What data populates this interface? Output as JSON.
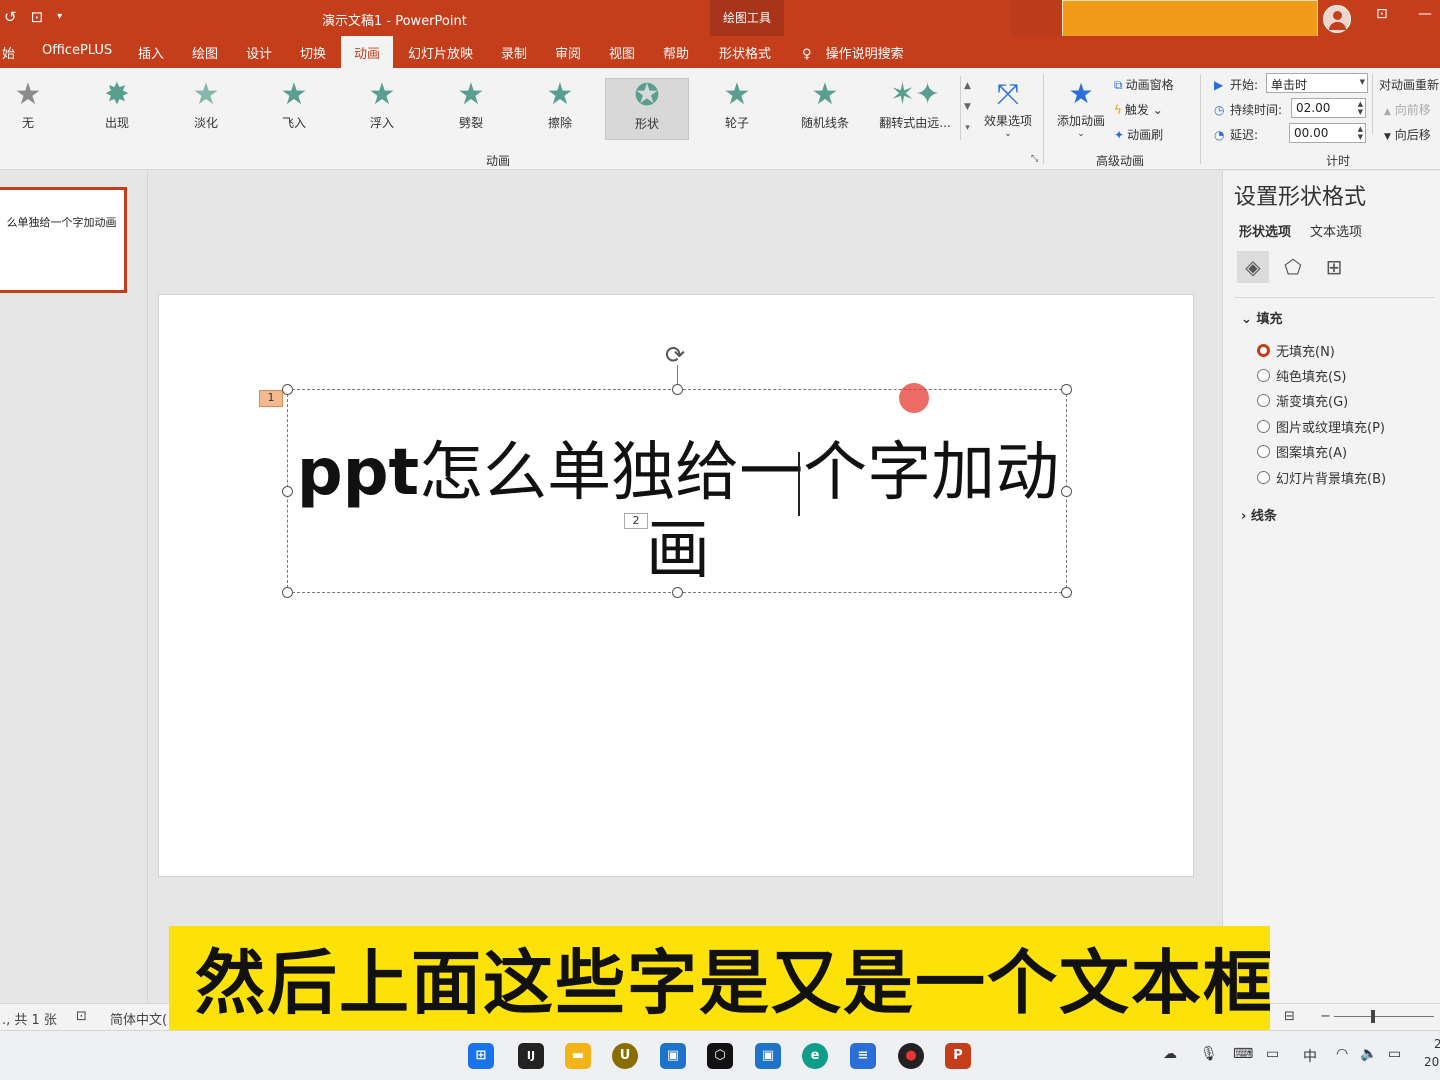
{
  "window": {
    "title": "演示文稿1  -  PowerPoint",
    "contextual_tab_header": "绘图工具"
  },
  "tabs": [
    {
      "label": "始"
    },
    {
      "label": "OfficePLUS"
    },
    {
      "label": "插入"
    },
    {
      "label": "绘图"
    },
    {
      "label": "设计"
    },
    {
      "label": "切换"
    },
    {
      "label": "动画",
      "active": true
    },
    {
      "label": "幻灯片放映"
    },
    {
      "label": "录制"
    },
    {
      "label": "审阅"
    },
    {
      "label": "视图"
    },
    {
      "label": "帮助"
    },
    {
      "label": "形状格式"
    },
    {
      "label": "操作说明搜索"
    }
  ],
  "ribbon": {
    "animations": [
      {
        "label": "无"
      },
      {
        "label": "出现"
      },
      {
        "label": "淡化"
      },
      {
        "label": "飞入"
      },
      {
        "label": "浮入"
      },
      {
        "label": "劈裂"
      },
      {
        "label": "擦除"
      },
      {
        "label": "形状",
        "selected": true
      },
      {
        "label": "轮子"
      },
      {
        "label": "随机线条"
      },
      {
        "label": "翻转式由远..."
      }
    ],
    "effect_options": "效果选项",
    "animation_group_label": "动画",
    "add_animation": "添加动画",
    "animation_pane": "动画窗格",
    "trigger": "触发",
    "animation_painter": "动画刷",
    "advanced_group_label": "高级动画",
    "start_label": "开始:",
    "start_value": "单击时",
    "duration_label": "持续时间:",
    "duration_value": "02.00",
    "delay_label": "延迟:",
    "delay_value": "00.00",
    "timing_group_label": "计时",
    "reorder_label": "对动画重新",
    "move_earlier": "向前移",
    "move_later": "向后移"
  },
  "slide_thumbnail": {
    "text": "么单独给一个字加动画"
  },
  "slide": {
    "text_bold": "ppt",
    "text_rest": "怎么单独给一个字加动画",
    "tag_1": "1",
    "tag_2": "2"
  },
  "format_pane": {
    "title": "设置形状格式",
    "tab_shape": "形状选项",
    "tab_text": "文本选项",
    "fill_section": "填充",
    "fill_options": [
      {
        "label": "无填充(N)",
        "checked": true
      },
      {
        "label": "纯色填充(S)"
      },
      {
        "label": "渐变填充(G)"
      },
      {
        "label": "图片或纹理填充(P)"
      },
      {
        "label": "图案填充(A)"
      },
      {
        "label": "幻灯片背景填充(B)"
      }
    ],
    "line_section": "线条"
  },
  "statusbar": {
    "slide_count": "., 共 1 张",
    "language": "简体中文("
  },
  "subtitle": "然后上面这些字是又是一个文本框",
  "taskbar": {
    "tray_ime": "中",
    "clock_line1": "2",
    "clock_line2": "20"
  }
}
